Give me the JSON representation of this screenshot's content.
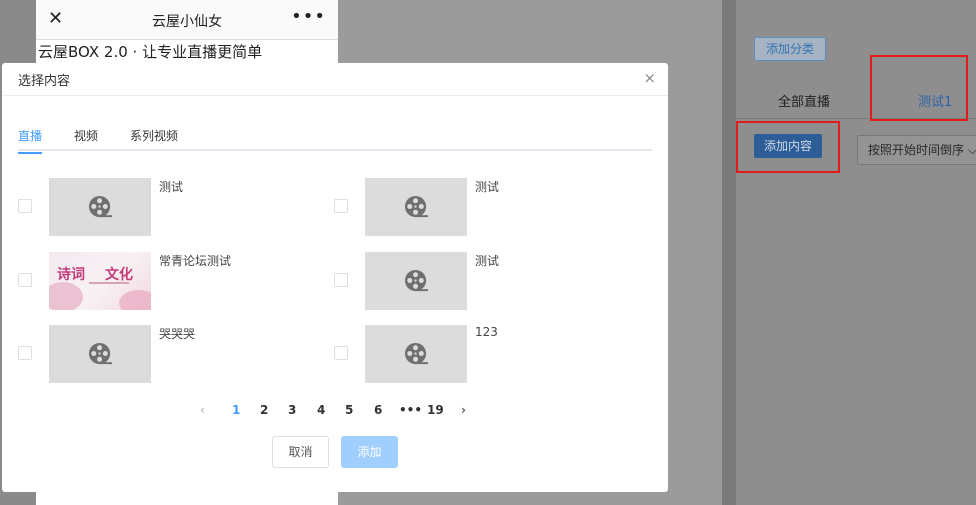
{
  "phone": {
    "title": "云屋小仙女",
    "close_glyph": "✕",
    "more_glyph": "•••",
    "banner": "云屋BOX 2.0 · 让专业直播更简单"
  },
  "right_panel": {
    "add_category": "添加分类",
    "tab_all": "全部直播",
    "tab_test1": "测试1",
    "add_content": "添加内容",
    "sort_select": "按照开始时间倒序 ⌵"
  },
  "modal": {
    "title": "选择内容",
    "close_glyph": "×",
    "tabs": [
      "直播",
      "视频",
      "系列视频"
    ],
    "items": [
      {
        "name": "测试",
        "thumb": "film-reel-icon"
      },
      {
        "name": "测试",
        "thumb": "film-reel-icon"
      },
      {
        "name": "常青论坛测试",
        "thumb": "poster-image"
      },
      {
        "name": "测试",
        "thumb": "film-reel-icon"
      },
      {
        "name": "哭哭哭",
        "thumb": "film-reel-icon"
      },
      {
        "name": "123",
        "thumb": "film-reel-icon"
      }
    ],
    "poster_text": [
      "诗词",
      "文化"
    ],
    "pagination": {
      "prev": "‹",
      "pages": [
        "1",
        "2",
        "3",
        "4",
        "5",
        "6",
        "•••",
        "19"
      ],
      "current": "1",
      "next": "›"
    },
    "cancel": "取消",
    "confirm": "添加"
  },
  "colors": {
    "accent": "#409eff",
    "highlight_box": "#e21c1c",
    "confirm_disabled": "#a0cfff"
  }
}
